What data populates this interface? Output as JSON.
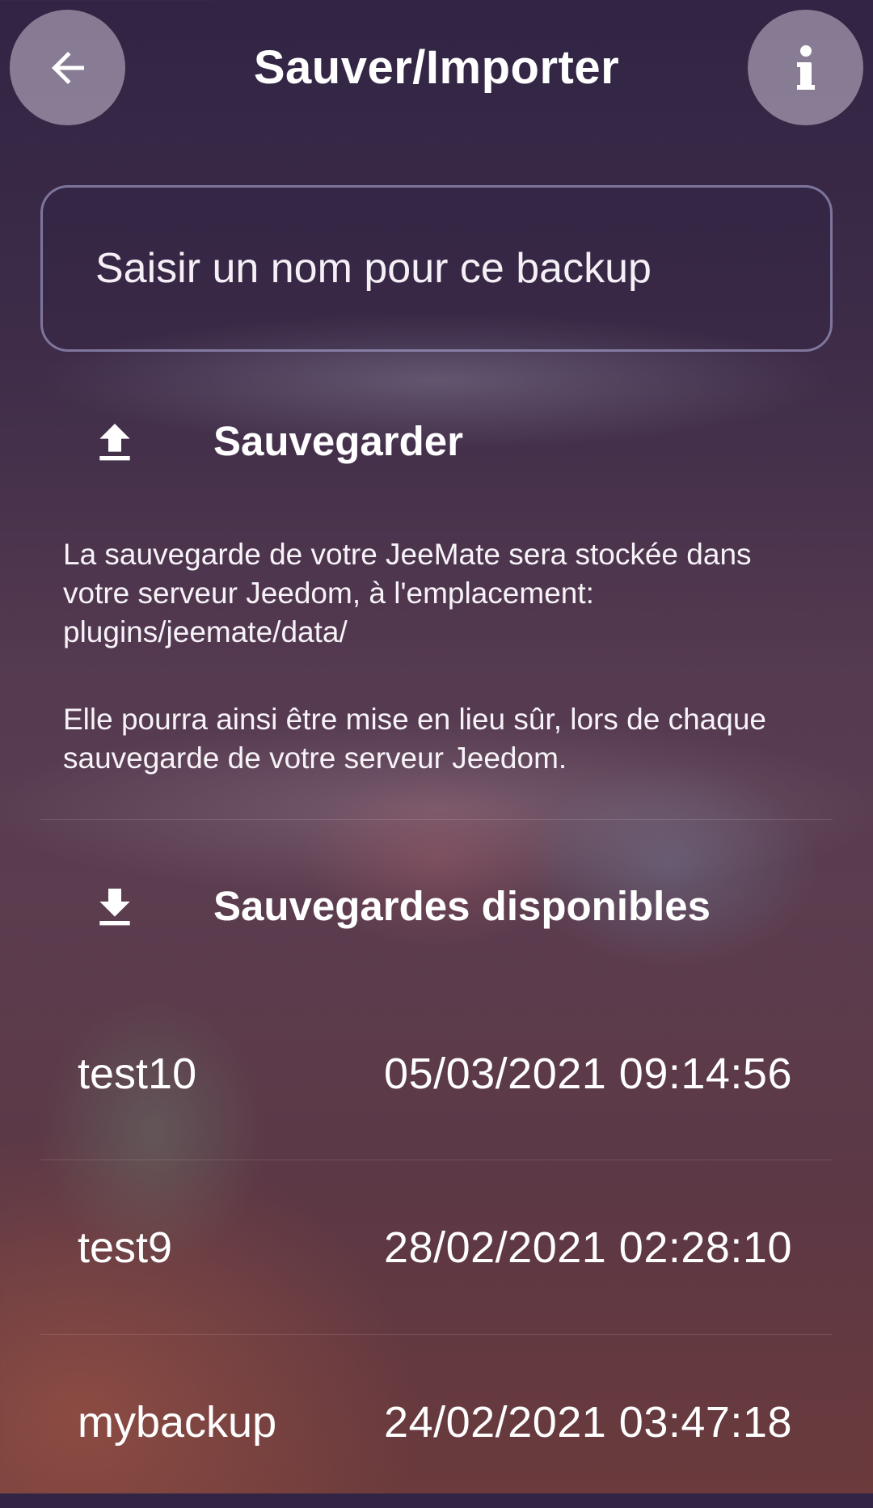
{
  "header": {
    "title": "Sauver/Importer",
    "back_icon": "arrow-left-icon",
    "info_icon": "info-icon"
  },
  "backup_name": {
    "placeholder": "Saisir un nom pour ce backup",
    "value": ""
  },
  "save": {
    "label": "Sauvegarder",
    "icon": "upload-icon",
    "description_1": "La sauvegarde de votre JeeMate sera stockée dans votre serveur Jeedom, à l'emplacement: plugins/jeemate/data/",
    "description_2": "Elle pourra ainsi être mise en lieu sûr, lors de chaque sauvegarde de votre serveur Jeedom."
  },
  "available": {
    "label": "Sauvegardes disponibles",
    "icon": "download-icon",
    "backups": [
      {
        "name": "test10",
        "date": "05/03/2021 09:14:56"
      },
      {
        "name": "test9",
        "date": "28/02/2021 02:28:10"
      },
      {
        "name": "mybackup",
        "date": "24/02/2021 03:47:18"
      }
    ]
  },
  "colors": {
    "text": "#ffffff",
    "button_bg": "#cdc3d7",
    "input_border": "#afaad7"
  }
}
